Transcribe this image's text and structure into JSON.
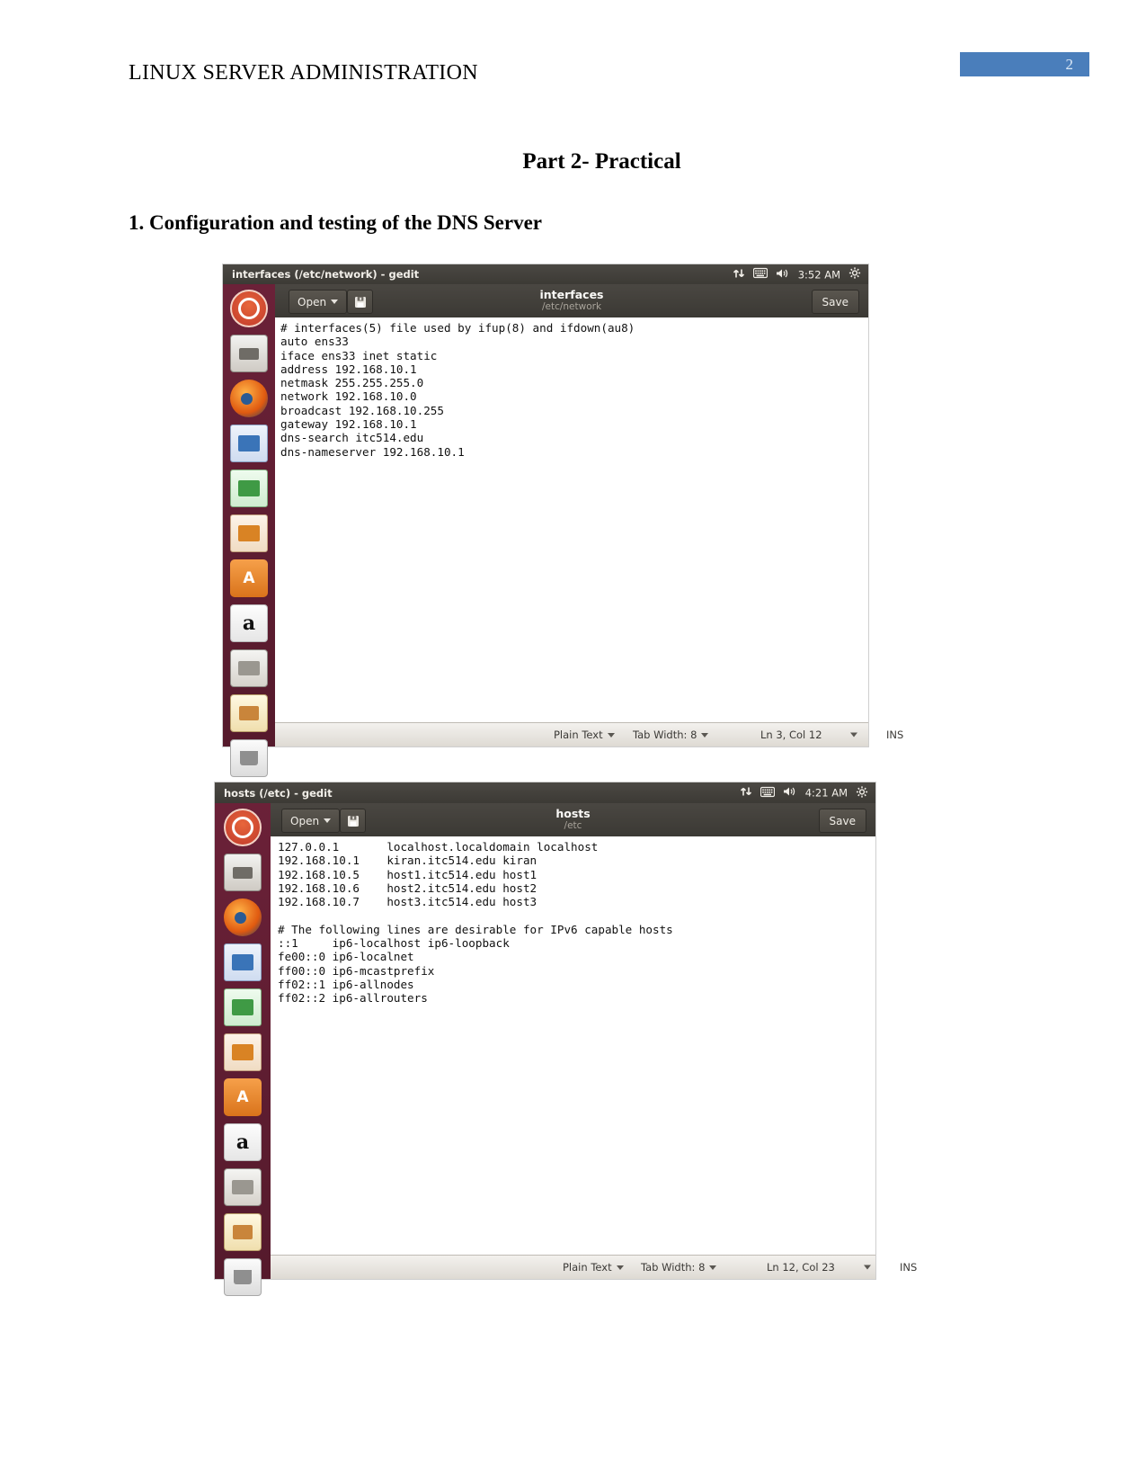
{
  "document": {
    "header_title": "LINUX SERVER ADMINISTRATION",
    "page_number": "2",
    "accent_color": "#4a7ebb",
    "section_title": "Part 2- Practical",
    "subsection_title": "1. Configuration and testing of the DNS Server"
  },
  "window1": {
    "titlebar": "interfaces (/etc/network) - gedit",
    "clock": "3:52 AM",
    "open_label": "Open",
    "doc_name": "interfaces",
    "doc_path": "/etc/network",
    "save_label": "Save",
    "content": "# interfaces(5) file used by ifup(8) and ifdown(au8)\nauto ens33\niface ens33 inet static\naddress 192.168.10.1\nnetmask 255.255.255.0\nnetwork 192.168.10.0\nbroadcast 192.168.10.255\ngateway 192.168.10.1\ndns-search itc514.edu\ndns-nameserver 192.168.10.1",
    "status": {
      "language": "Plain Text",
      "tab_width": "Tab Width: 8",
      "position": "Ln 3, Col 12",
      "insert_mode": "INS"
    }
  },
  "window2": {
    "titlebar": "hosts (/etc) - gedit",
    "clock": "4:21 AM",
    "open_label": "Open",
    "doc_name": "hosts",
    "doc_path": "/etc",
    "save_label": "Save",
    "content": "127.0.0.1       localhost.localdomain localhost\n192.168.10.1    kiran.itc514.edu kiran\n192.168.10.5    host1.itc514.edu host1\n192.168.10.6    host2.itc514.edu host2\n192.168.10.7    host3.itc514.edu host3\n\n# The following lines are desirable for IPv6 capable hosts\n::1     ip6-localhost ip6-loopback\nfe00::0 ip6-localnet\nff00::0 ip6-mcastprefix\nff02::1 ip6-allnodes\nff02::2 ip6-allrouters",
    "status": {
      "language": "Plain Text",
      "tab_width": "Tab Width: 8",
      "position": "Ln 12, Col 23",
      "insert_mode": "INS"
    }
  },
  "launcher": {
    "items": [
      {
        "name": "ubuntu-dash-icon",
        "cls": "ubuntu"
      },
      {
        "name": "files-icon",
        "cls": "files"
      },
      {
        "name": "firefox-icon",
        "cls": "firefox"
      },
      {
        "name": "libreoffice-writer-icon",
        "cls": "writer"
      },
      {
        "name": "libreoffice-calc-icon",
        "cls": "calc"
      },
      {
        "name": "libreoffice-impress-icon",
        "cls": "impress"
      },
      {
        "name": "ubuntu-software-icon",
        "cls": "software"
      },
      {
        "name": "amazon-icon",
        "cls": "amazon"
      },
      {
        "name": "system-settings-icon",
        "cls": "settings"
      },
      {
        "name": "text-editor-icon",
        "cls": "notes"
      },
      {
        "name": "trash-icon",
        "cls": "trash"
      }
    ]
  }
}
